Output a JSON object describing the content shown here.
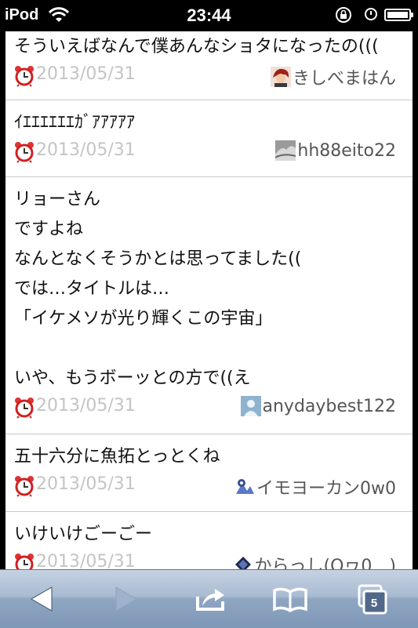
{
  "status_bar": {
    "carrier": "iPod",
    "time": "23:44"
  },
  "posts": [
    {
      "text": "そういえばなんで僕あんなショタになったの(((",
      "date": "2013/05/31",
      "user": "きしべまはん"
    },
    {
      "text": "ｲｴｴｴｴｴｴｶﾞｱｱｱｱｱ",
      "date": "2013/05/31",
      "user": "hh88eito22"
    },
    {
      "text": "リョーさん\nですよね\nなんとなくそうかとは思ってました((\nでは…タイトルは…\n「イケメソが光り輝くこの宇宙」\n\nいや、もうボーッとの方で((え",
      "date": "2013/05/31",
      "user": "anydaybest122"
    },
    {
      "text": "五十六分に魚拓とっとくね",
      "date": "2013/05/31",
      "user": "イモヨーカン0w0"
    },
    {
      "text": "いけいけごーごー",
      "date": "2013/05/31",
      "user": "からっし(Oヮ0　)"
    }
  ],
  "toolbar": {
    "tab_count": "5",
    "icons": [
      "back-arrow-icon",
      "forward-arrow-icon",
      "share-icon",
      "bookmarks-icon",
      "tabs-icon"
    ]
  },
  "colors": {
    "date": "#c4c4c4",
    "toolbar_top": "#c5d2e2",
    "toolbar_bottom": "#7f97b7"
  }
}
